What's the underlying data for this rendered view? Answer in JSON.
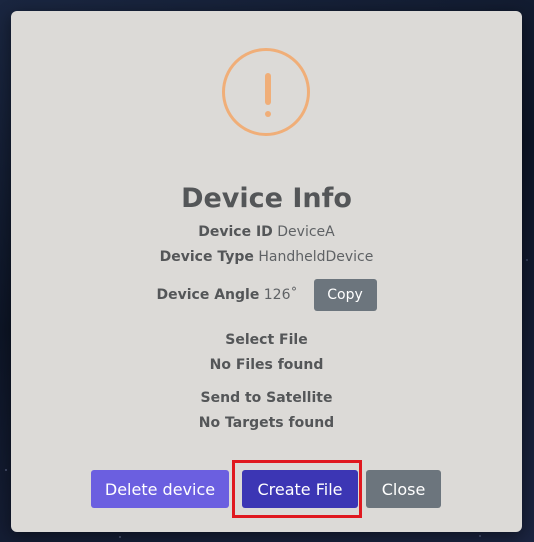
{
  "dialog": {
    "title": "Device Info",
    "device_id_label": "Device ID",
    "device_id_value": "DeviceA",
    "device_type_label": "Device Type",
    "device_type_value": "HandheldDevice",
    "device_angle_label": "Device Angle",
    "device_angle_value": "126˚",
    "copy_label": "Copy",
    "select_file_heading": "Select File",
    "no_files_text": "No Files found",
    "send_heading": "Send to Satellite",
    "no_targets_text": "No Targets found"
  },
  "actions": {
    "delete_label": "Delete device",
    "create_label": "Create File",
    "close_label": "Close"
  },
  "colors": {
    "modal_bg": "#dcdad7",
    "warning": "#f0ae78",
    "primary": "#6b5fe0",
    "primary_active": "#3c36b4",
    "secondary": "#6c757d",
    "highlight": "#e0181f"
  },
  "icons": {
    "warning": "exclamation-circle-icon"
  }
}
